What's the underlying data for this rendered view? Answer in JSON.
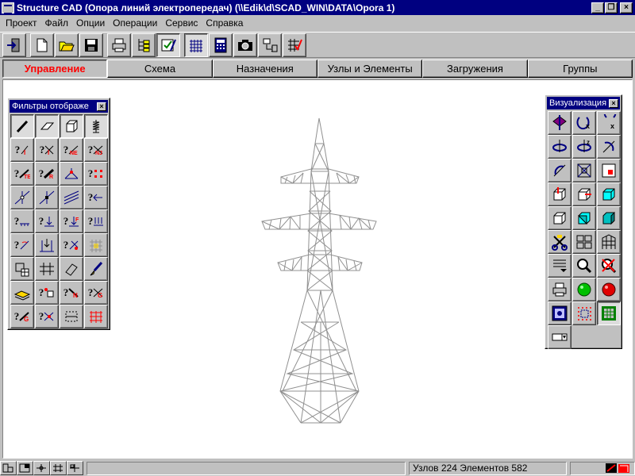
{
  "window": {
    "title": "Structure CAD (Опора линий электропередач) (\\\\Edik\\d\\SCAD_WIN\\DATA\\Opora 1)"
  },
  "menu": [
    "Проект",
    "Файл",
    "Опции",
    "Операции",
    "Сервис",
    "Справка"
  ],
  "tabs": [
    "Управление",
    "Схема",
    "Назначения",
    "Узлы и Элементы",
    "Загружения",
    "Группы"
  ],
  "active_tab": "Управление",
  "filters_palette": {
    "title": "Фильтры отображе"
  },
  "visual_palette": {
    "title": "Визуализация"
  },
  "status": {
    "text": "Узлов 224 Элементов 582"
  },
  "colors": {
    "title_bar": "#000080",
    "active_tab": "#ff0000",
    "background": "#c0c0c0"
  }
}
